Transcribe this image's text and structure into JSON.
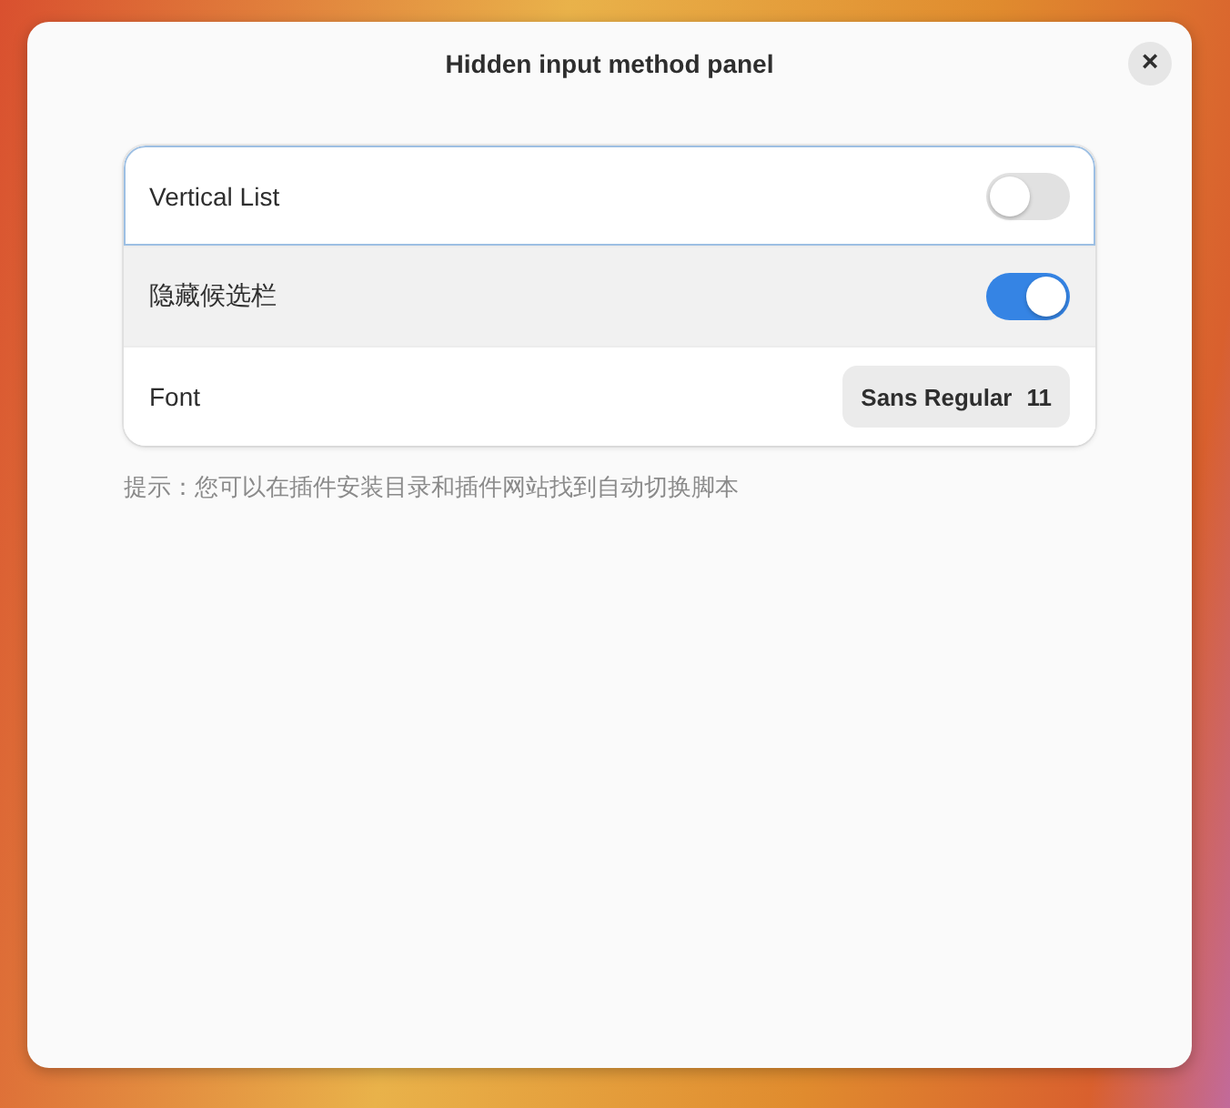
{
  "window": {
    "title": "Hidden input method panel",
    "close": "×"
  },
  "rows": [
    {
      "kind": "switch",
      "label": "Vertical List",
      "on": false,
      "focused": true,
      "highlighted": false
    },
    {
      "kind": "switch",
      "label": "隐藏候选栏",
      "on": true,
      "focused": false,
      "highlighted": true
    },
    {
      "kind": "font",
      "label": "Font",
      "font_name": "Sans Regular",
      "font_size": "11",
      "focused": false,
      "highlighted": false
    }
  ],
  "hint": "提示：您可以在插件安装目录和插件网站找到自动切换脚本"
}
